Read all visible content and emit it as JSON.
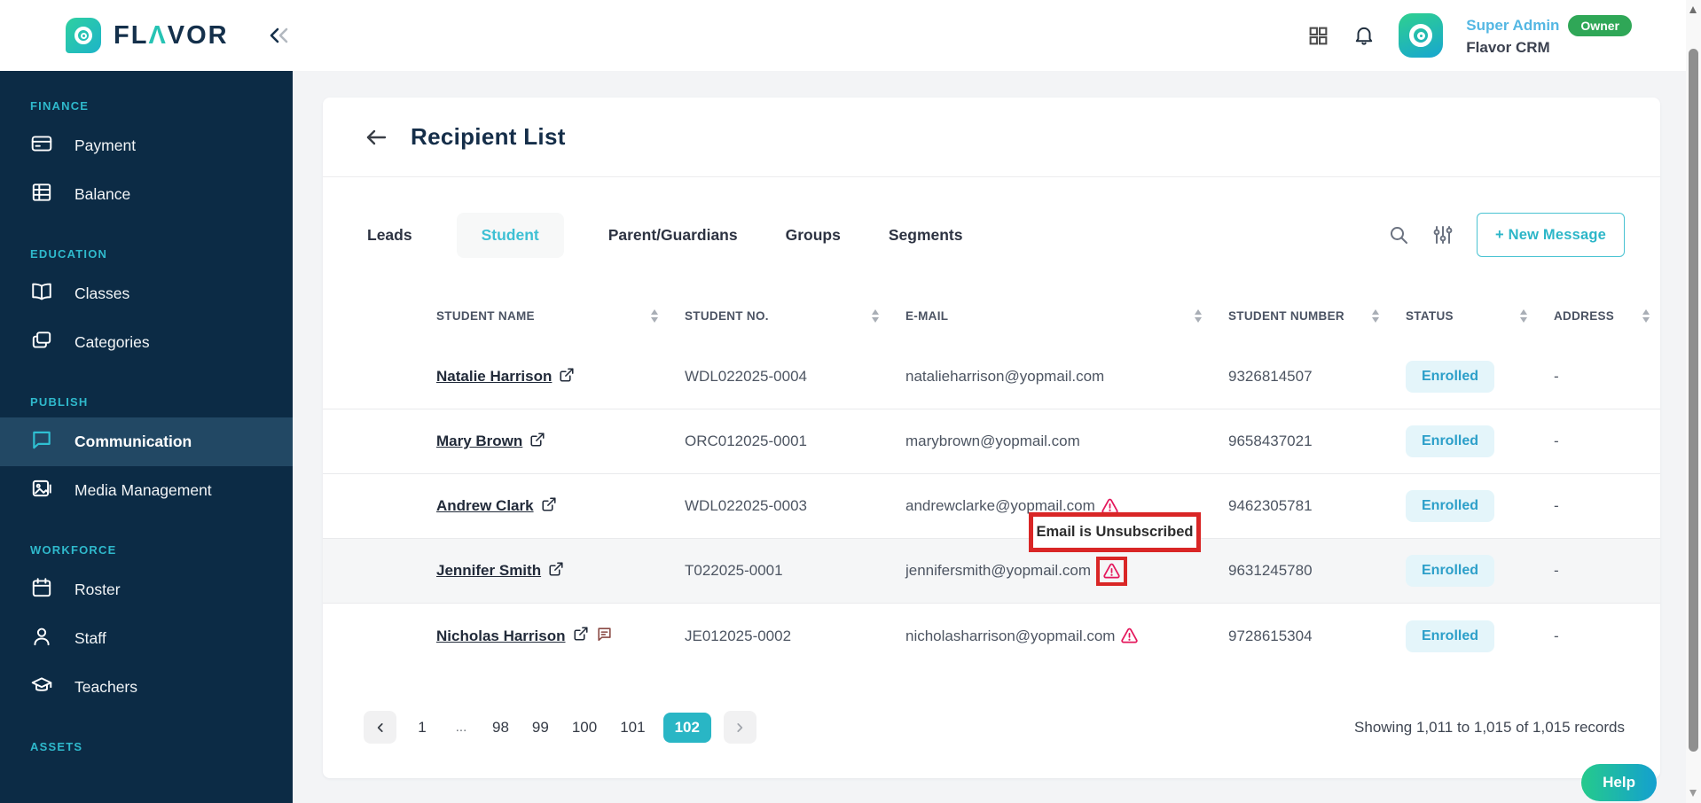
{
  "topbar": {
    "logo": {
      "pre": "FL",
      "accent": "Λ",
      "post": "VOR"
    },
    "user_name": "Super Admin",
    "user_badge": "Owner",
    "workspace": "Flavor CRM"
  },
  "sidebar": {
    "sections": [
      {
        "label": "FINANCE",
        "items": [
          {
            "label": "Payment"
          },
          {
            "label": "Balance"
          }
        ]
      },
      {
        "label": "EDUCATION",
        "items": [
          {
            "label": "Classes"
          },
          {
            "label": "Categories"
          }
        ]
      },
      {
        "label": "PUBLISH",
        "items": [
          {
            "label": "Communication",
            "active": true
          },
          {
            "label": "Media Management"
          }
        ]
      },
      {
        "label": "WORKFORCE",
        "items": [
          {
            "label": "Roster"
          },
          {
            "label": "Staff"
          },
          {
            "label": "Teachers"
          }
        ]
      },
      {
        "label": "ASSETS",
        "items": []
      }
    ]
  },
  "page": {
    "title": "Recipient List",
    "tabs": [
      {
        "label": "Leads"
      },
      {
        "label": "Student",
        "active": true
      },
      {
        "label": "Parent/Guardians"
      },
      {
        "label": "Groups"
      },
      {
        "label": "Segments"
      }
    ],
    "new_message_label": "+ New Message"
  },
  "table": {
    "columns": [
      "STUDENT NAME",
      "STUDENT NO.",
      "E-MAIL",
      "STUDENT NUMBER",
      "STATUS",
      "ADDRESS"
    ],
    "rows": [
      {
        "name": "Natalie Harrison",
        "student_no": "WDL022025-0004",
        "email": "natalieharrison@yopmail.com",
        "student_number": "9326814507",
        "status": "Enrolled",
        "address": "-"
      },
      {
        "name": "Mary Brown",
        "student_no": "ORC012025-0001",
        "email": "marybrown@yopmail.com",
        "student_number": "9658437021",
        "status": "Enrolled",
        "address": "-"
      },
      {
        "name": "Andrew Clark",
        "student_no": "WDL022025-0003",
        "email": "andrewclarke@yopmail.com",
        "student_number": "9462305781",
        "status": "Enrolled",
        "address": "-"
      },
      {
        "name": "Jennifer Smith",
        "student_no": "T022025-0001",
        "email": "jennifersmith@yopmail.com",
        "student_number": "9631245780",
        "status": "Enrolled",
        "address": "-"
      },
      {
        "name": "Nicholas Harrison",
        "student_no": "JE012025-0002",
        "email": "nicholasharrison@yopmail.com",
        "student_number": "9728615304",
        "status": "Enrolled",
        "address": "-"
      }
    ]
  },
  "tooltip": {
    "text": "Email is Unsubscribed"
  },
  "pagination": {
    "pages": [
      "1",
      "...",
      "98",
      "99",
      "100",
      "101",
      "102"
    ],
    "active_page": "102",
    "summary": "Showing 1,011 to 1,015 of 1,015 records"
  },
  "help_label": "Help",
  "colors": {
    "accent_teal": "#29B6C5",
    "sidebar_bg": "#0C2B45",
    "warning_pink": "#E4185C",
    "annotation_red": "#D92626",
    "owner_green": "#2FA757",
    "enrolled_bg": "#E4F5FA",
    "enrolled_text": "#2C9FC9",
    "super_admin_blue": "#54B7E3"
  }
}
